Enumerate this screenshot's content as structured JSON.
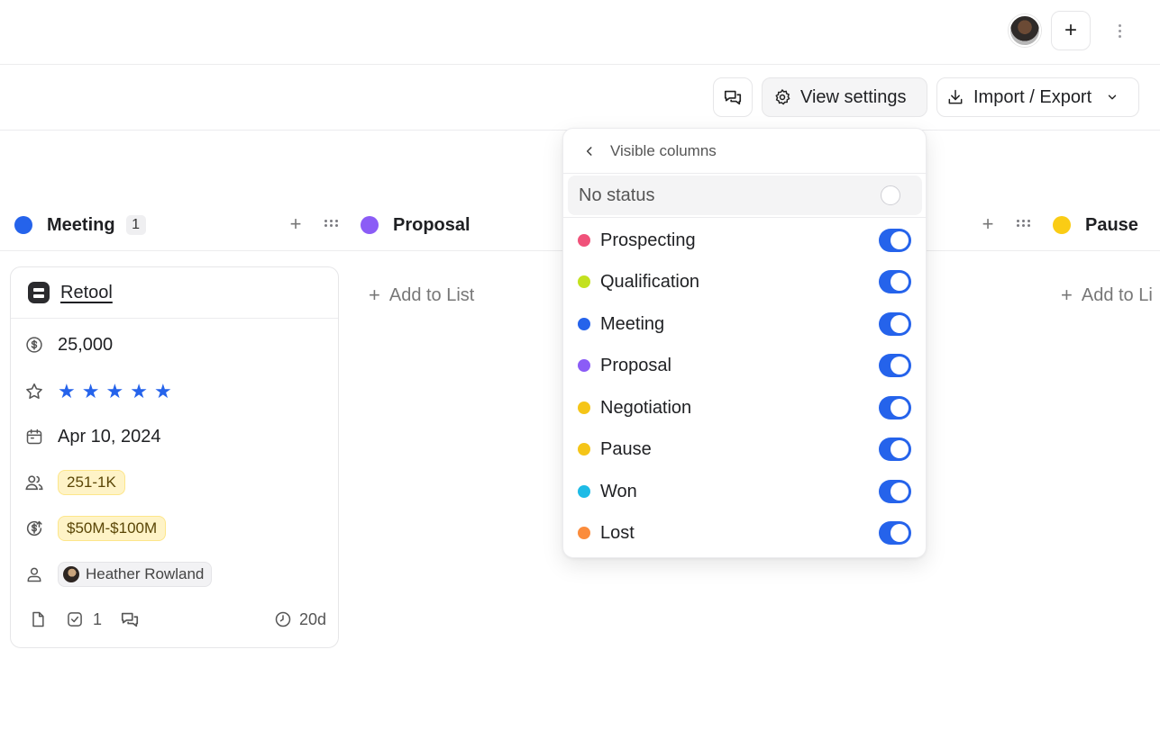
{
  "topbar": {
    "add_label": "+"
  },
  "toolbar": {
    "view_settings_label": "View settings",
    "import_export_label": "Import / Export"
  },
  "columns": [
    {
      "title": "Meeting",
      "count": "1",
      "color": "#2563eb"
    },
    {
      "title": "Proposal",
      "color": "#8b5cf6"
    },
    {
      "title": "Pause",
      "color": "#facc15"
    }
  ],
  "card": {
    "company": "Retool",
    "amount": "25,000",
    "rating": 5,
    "date": "Apr 10, 2024",
    "employees": "251-1K",
    "revenue": "$50M-$100M",
    "owner": "Heather Rowland",
    "tasks_count": "1",
    "age": "20d"
  },
  "add_to_list_label": "Add to List",
  "add_to_list_clipped_label": "Add to Li",
  "popover": {
    "title": "Visible columns",
    "no_status_label": "No status",
    "options": [
      {
        "label": "Prospecting",
        "color": "#f0527a",
        "visible": true
      },
      {
        "label": "Qualification",
        "color": "#c3e11f",
        "visible": true
      },
      {
        "label": "Meeting",
        "color": "#2563eb",
        "visible": true
      },
      {
        "label": "Proposal",
        "color": "#8b5cf6",
        "visible": true
      },
      {
        "label": "Negotiation",
        "color": "#f5c518",
        "visible": true
      },
      {
        "label": "Pause",
        "color": "#f5c518",
        "visible": true
      },
      {
        "label": "Won",
        "color": "#1ebbe6",
        "visible": true
      },
      {
        "label": "Lost",
        "color": "#fb8c3c",
        "visible": true
      }
    ]
  },
  "icons": {
    "comment": "comment-icon",
    "settings": "gear-icon",
    "download": "download-icon",
    "chevron": "chevron-down-icon",
    "back": "chevron-left-icon"
  }
}
